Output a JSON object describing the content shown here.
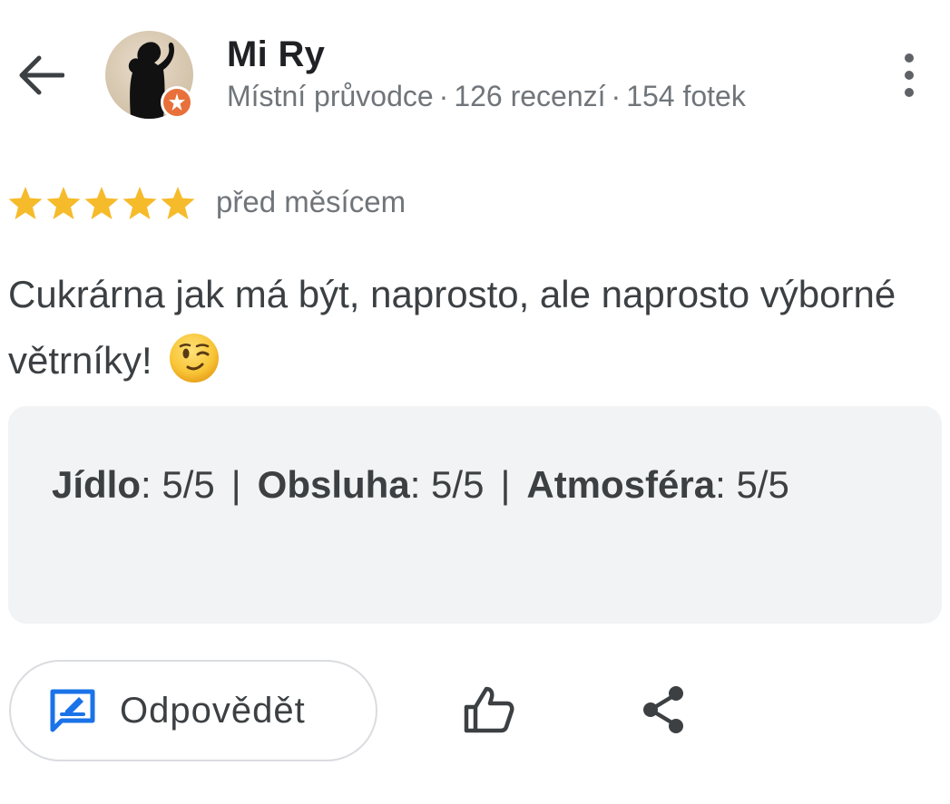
{
  "header": {
    "back_icon": "arrow-left-icon",
    "author_name": "Mi Ry",
    "author_role": "Místní průvodce",
    "separator": "·",
    "reviews_count": "126 recenzí",
    "photos_count": "154 fotek",
    "more_icon": "more-vertical-icon",
    "badge_color": "#e8703a"
  },
  "review": {
    "rating": 5,
    "rating_max": 5,
    "star_color": "#f6bb2b",
    "time_ago": "před měsícem",
    "text": "Cukrárna jak má být, naprosto, ale naprosto výborné větrníky!",
    "emoji": "winking-face"
  },
  "ratings": {
    "food_label": "Jídlo",
    "food_value": "5/5",
    "service_label": "Obsluha",
    "service_value": "5/5",
    "atmosphere_label": "Atmosféra",
    "atmosphere_value": "5/5",
    "colon": ":",
    "separator": "|"
  },
  "actions": {
    "reply_label": "Odpovědět",
    "reply_icon": "reply-edit-icon",
    "reply_icon_color": "#1a73e8",
    "like_icon": "thumb-up-icon",
    "share_icon": "share-icon"
  }
}
